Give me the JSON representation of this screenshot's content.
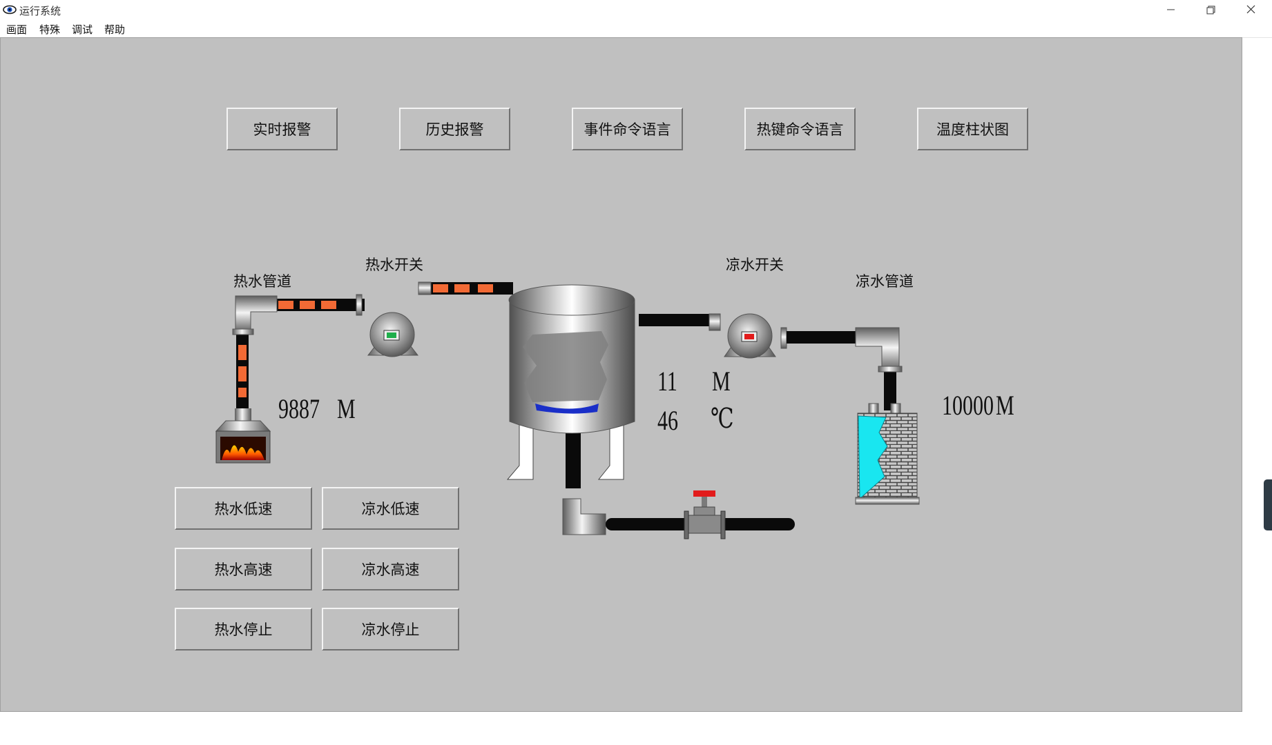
{
  "window": {
    "title": "运行系统",
    "controls": [
      "minimize",
      "restore",
      "close"
    ]
  },
  "menu": {
    "items": [
      "画面",
      "特殊",
      "调试",
      "帮助"
    ]
  },
  "nav_buttons": [
    "实时报警",
    "历史报警",
    "事件命令语言",
    "热键命令语言",
    "温度柱状图"
  ],
  "labels": {
    "hot_pipe": "热水管道",
    "hot_switch": "热水开关",
    "cold_switch": "凉水开关",
    "cold_pipe": "凉水管道"
  },
  "readings": {
    "hot_level_value": "9887",
    "hot_level_unit": "M",
    "tank_level_value": "11",
    "tank_level_unit": "M",
    "tank_temp_value": "46",
    "tank_temp_unit": "℃",
    "cold_level_value": "10000",
    "cold_level_unit": "M"
  },
  "control_buttons": {
    "hot_low": "热水低速",
    "cold_low": "凉水低速",
    "hot_high": "热水高速",
    "cold_high": "凉水高速",
    "hot_stop": "热水停止",
    "cold_stop": "凉水停止"
  },
  "status": {
    "hot_switch_indicator": "#1fae4b",
    "cold_switch_indicator": "#e21b1b",
    "hot_flow_color": "#f26a35",
    "tank_liquid_color": "#1a2fc8",
    "cold_water_color": "#19e6f0"
  },
  "icons": [
    "eye-icon",
    "minimize-icon",
    "restore-icon",
    "close-icon",
    "furnace-icon",
    "tank-icon",
    "tower-icon",
    "valve-icon",
    "pump-icon",
    "elbow-icon"
  ]
}
